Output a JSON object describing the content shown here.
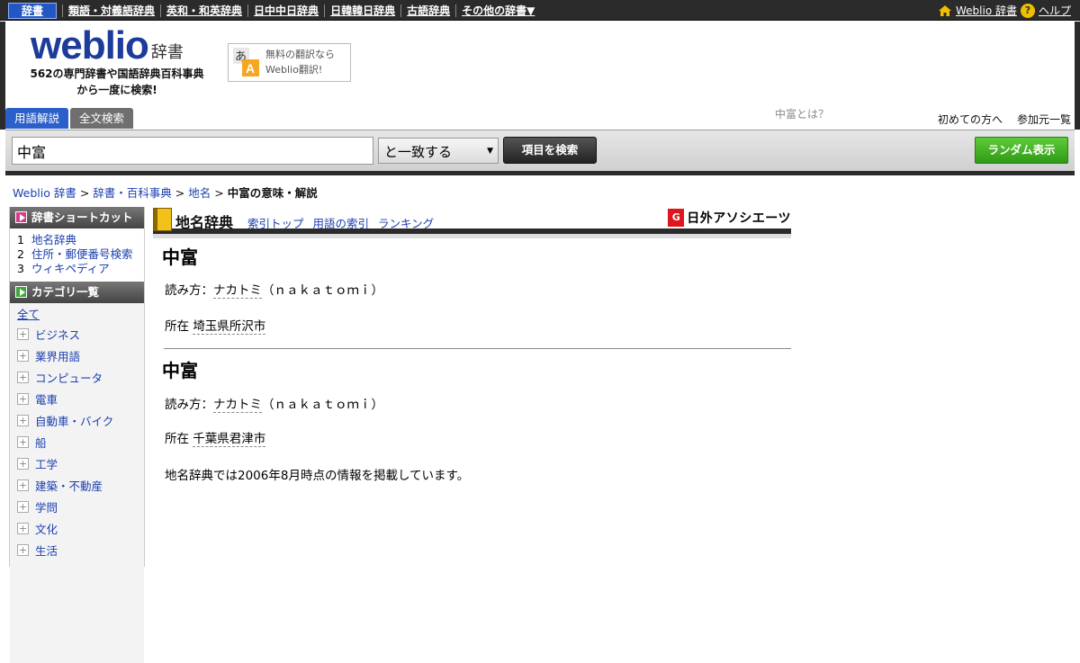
{
  "topnav": {
    "items": [
      "辞書",
      "類語・対義語辞典",
      "英和・和英辞典",
      "日中中日辞典",
      "日韓韓日辞典",
      "古語辞典",
      "その他の辞書▼"
    ],
    "site_link": "Weblio 辞書",
    "help_link": "ヘルプ"
  },
  "header": {
    "logo_text": "weblio",
    "logo_suffix": "辞書",
    "tagline_line1": "562の専門辞書や国語辞典百科事典",
    "tagline_line2": "から一度に検索!",
    "translate_line1": "無料の翻訳なら",
    "translate_line2": "Weblio翻訳!",
    "tabs": [
      "用語解説",
      "全文検索"
    ],
    "what_is": "中富とは？",
    "first_time": "初めての方へ",
    "sources": "参加元一覧"
  },
  "search": {
    "query": "中富",
    "match_mode": "と一致する",
    "search_button": "項目を検索",
    "random_button": "ランダム表示"
  },
  "breadcrumb": {
    "items": [
      "Weblio 辞書",
      "辞書・百科事典",
      "地名"
    ],
    "current": "中富の意味・解説",
    "sep": ">"
  },
  "sidebar": {
    "shortcut_title": "辞書ショートカット",
    "shortcuts": [
      {
        "num": "1",
        "label": "地名辞典"
      },
      {
        "num": "2",
        "label": "住所・郵便番号検索"
      },
      {
        "num": "3",
        "label": "ウィキペディア"
      }
    ],
    "category_title": "カテゴリ一覧",
    "all_label": "全て",
    "categories": [
      "ビジネス",
      "業界用語",
      "コンピュータ",
      "電車",
      "自動車・バイク",
      "船",
      "工学",
      "建築・不動産",
      "学問",
      "文化",
      "生活"
    ]
  },
  "dictionary": {
    "name": "地名辞典",
    "links": [
      "索引トップ",
      "用語の索引",
      "ランキング"
    ],
    "publisher": "日外アソシエーツ",
    "publisher_mark": "G"
  },
  "entries": [
    {
      "title": "中富",
      "reading_label": "読み方：",
      "reading": "ナカトミ",
      "romaji": "（ｎａｋａｔｏｍｉ）",
      "location_label": "所在",
      "location": "埼玉県所沢市"
    },
    {
      "title": "中富",
      "reading_label": "読み方：",
      "reading": "ナカトミ",
      "romaji": "（ｎａｋａｔｏｍｉ）",
      "location_label": "所在",
      "location": "千葉県君津市"
    }
  ],
  "footnote": "地名辞典では2006年8月時点の情報を掲載しています。",
  "colors": {
    "brand": "#1c3b9a",
    "link": "#1a3fb0",
    "topbar": "#2b2b2b",
    "random": "#2f9a17"
  }
}
